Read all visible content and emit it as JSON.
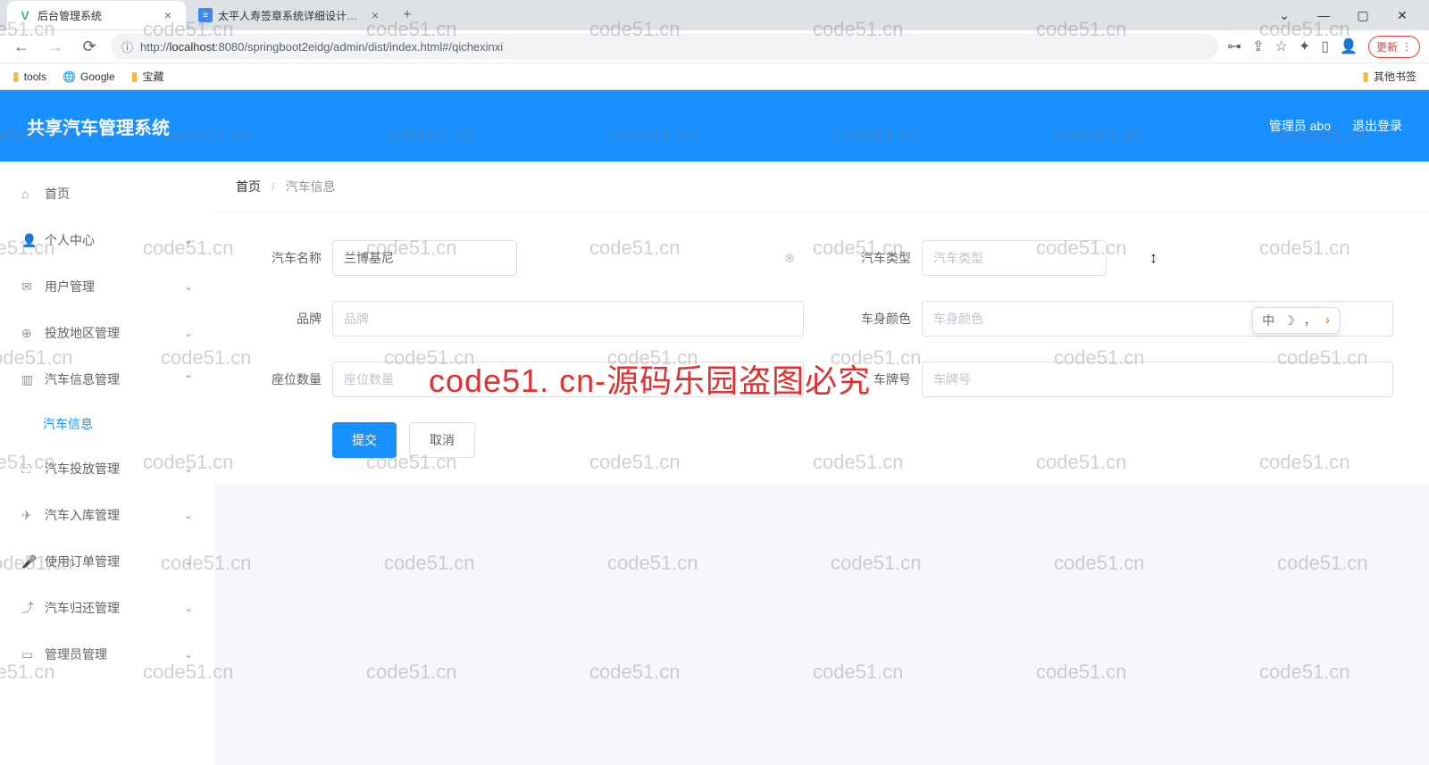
{
  "browser": {
    "tabs": [
      {
        "title": "后台管理系统",
        "favicon": "vue"
      },
      {
        "title": "太平人寿签章系统详细设计文档",
        "favicon": "doc"
      }
    ],
    "url_prefix": "http://",
    "url_host": "localhost",
    "url_rest": ":8080/springboot2eidg/admin/dist/index.html#/qichexinxi",
    "update_label": "更新",
    "bookmarks": {
      "tools": "tools",
      "google": "Google",
      "baozang": "宝藏",
      "other": "其他书签"
    }
  },
  "header": {
    "title": "共享汽车管理系统",
    "user": "管理员 abo",
    "logout": "退出登录"
  },
  "sidebar": {
    "home": "首页",
    "profile": "个人中心",
    "users": "用户管理",
    "region": "投放地区管理",
    "carinfo": "汽车信息管理",
    "carinfo_sub": "汽车信息",
    "deploy": "汽车投放管理",
    "inbound": "汽车入库管理",
    "orders": "使用订单管理",
    "return": "汽车归还管理",
    "admins": "管理员管理"
  },
  "breadcrumb": {
    "home": "首页",
    "current": "汽车信息"
  },
  "form": {
    "name_label": "汽车名称",
    "name_value": "兰博基尼",
    "type_label": "汽车类型",
    "type_placeholder": "汽车类型",
    "brand_label": "品牌",
    "brand_placeholder": "品牌",
    "color_label": "车身颜色",
    "color_placeholder": "车身颜色",
    "seats_label": "座位数量",
    "seats_placeholder": "座位数量",
    "plate_label": "车牌号",
    "plate_placeholder": "车牌号",
    "submit": "提交",
    "cancel": "取消"
  },
  "watermark_text": "code51.cn",
  "watermark_red": "code51. cn-源码乐园盗图必究",
  "ime": {
    "lang": "中",
    "moon": "☽",
    "comma": "，"
  }
}
